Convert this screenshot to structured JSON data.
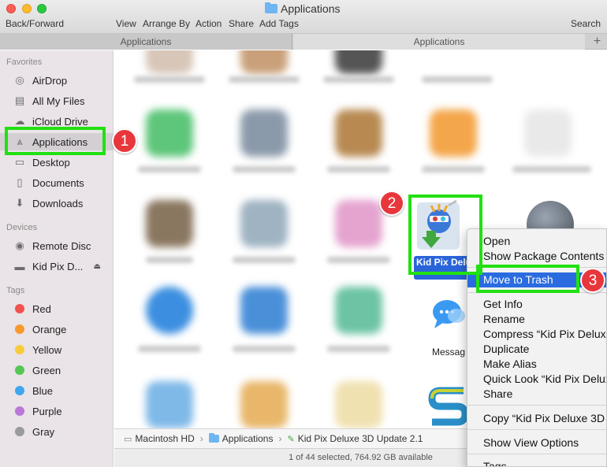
{
  "window": {
    "title": "Applications",
    "toolbar": {
      "back_forward": "Back/Forward",
      "view": "View",
      "arrange_by": "Arrange By",
      "action": "Action",
      "share": "Share",
      "add_tags": "Add Tags",
      "search": "Search"
    },
    "tabs": [
      "Applications",
      "Applications"
    ],
    "tab_add": "+"
  },
  "sidebar": {
    "favorites_heading": "Favorites",
    "favorites": [
      {
        "label": "AirDrop",
        "icon": "airdrop-icon"
      },
      {
        "label": "All My Files",
        "icon": "all-files-icon"
      },
      {
        "label": "iCloud Drive",
        "icon": "cloud-icon"
      },
      {
        "label": "Applications",
        "icon": "applications-icon"
      },
      {
        "label": "Desktop",
        "icon": "desktop-icon"
      },
      {
        "label": "Documents",
        "icon": "documents-icon"
      },
      {
        "label": "Downloads",
        "icon": "downloads-icon"
      }
    ],
    "devices_heading": "Devices",
    "devices": [
      {
        "label": "Remote Disc",
        "icon": "disc-icon"
      },
      {
        "label": "Kid Pix D...",
        "icon": "drive-icon"
      }
    ],
    "tags_heading": "Tags",
    "tags": [
      {
        "label": "Red",
        "color": "#f2524f"
      },
      {
        "label": "Orange",
        "color": "#f79a2e"
      },
      {
        "label": "Yellow",
        "color": "#f6cc3a"
      },
      {
        "label": "Green",
        "color": "#55c653"
      },
      {
        "label": "Blue",
        "color": "#3fa6ef"
      },
      {
        "label": "Purple",
        "color": "#bb77d6"
      },
      {
        "label": "Gray",
        "color": "#9a9a9a"
      }
    ]
  },
  "main": {
    "selected_file_label": "Kid Pix Deluxe 3D Update 2.1",
    "selected_file_short": "Kid Pix Deluxe",
    "messages_label": "Messag"
  },
  "pathbar": {
    "items": [
      "Macintosh HD",
      "Applications",
      "Kid Pix Deluxe 3D Update 2.1"
    ]
  },
  "statusbar": {
    "text": "1 of 44 selected, 764.92 GB available"
  },
  "context_menu": {
    "items": [
      "Open",
      "Show Package Contents",
      "Move to Trash",
      "Get Info",
      "Rename",
      "Compress “Kid Pix Delux",
      "Duplicate",
      "Make Alias",
      "Quick Look “Kid Pix Delux",
      "Share",
      "Copy “Kid Pix Deluxe 3D",
      "Show View Options",
      "Tags..."
    ],
    "highlighted": "Move to Trash"
  },
  "annotations": {
    "steps": [
      "1",
      "2",
      "3"
    ],
    "highlight_color": "#22e012",
    "badge_color": "#e8373c"
  }
}
